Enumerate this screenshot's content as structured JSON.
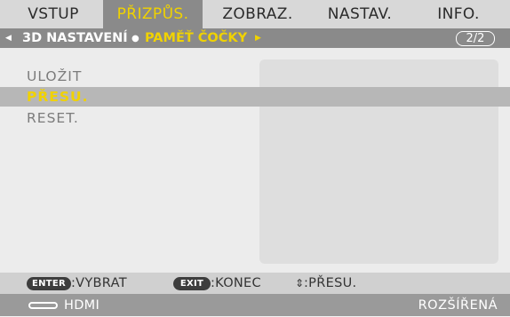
{
  "tabs": [
    {
      "label": "VSTUP"
    },
    {
      "label": "PŘIZPŮS."
    },
    {
      "label": "ZOBRAZ."
    },
    {
      "label": "NASTAV."
    },
    {
      "label": "INFO."
    }
  ],
  "active_tab": "PŘIZPŮS.",
  "breadcrumb": {
    "left_arrow": "◀",
    "parent": "3D NASTAVENÍ",
    "separator": "●",
    "current": "PAMĚŤ ČOČKY",
    "right_arrow": "▶",
    "pager": "2/2"
  },
  "menu": {
    "items": [
      {
        "label": "ULOŽIT"
      },
      {
        "label": "PŘESU."
      },
      {
        "label": "RESET."
      }
    ],
    "selected": "PŘESU."
  },
  "footer": {
    "enter_key": "ENTER",
    "enter_label": ":VYBRAT",
    "exit_key": "EXIT",
    "exit_label": ":KONEC",
    "move_glyph": "⇕",
    "move_label": ":PŘESU."
  },
  "status": {
    "source": "HDMI",
    "mode": "ROZŠÍŘENÁ"
  },
  "colors": {
    "highlight_text": "#f0d200",
    "active_tab_bg": "#8a8a8a",
    "selection_bg": "#b7b7b7"
  }
}
